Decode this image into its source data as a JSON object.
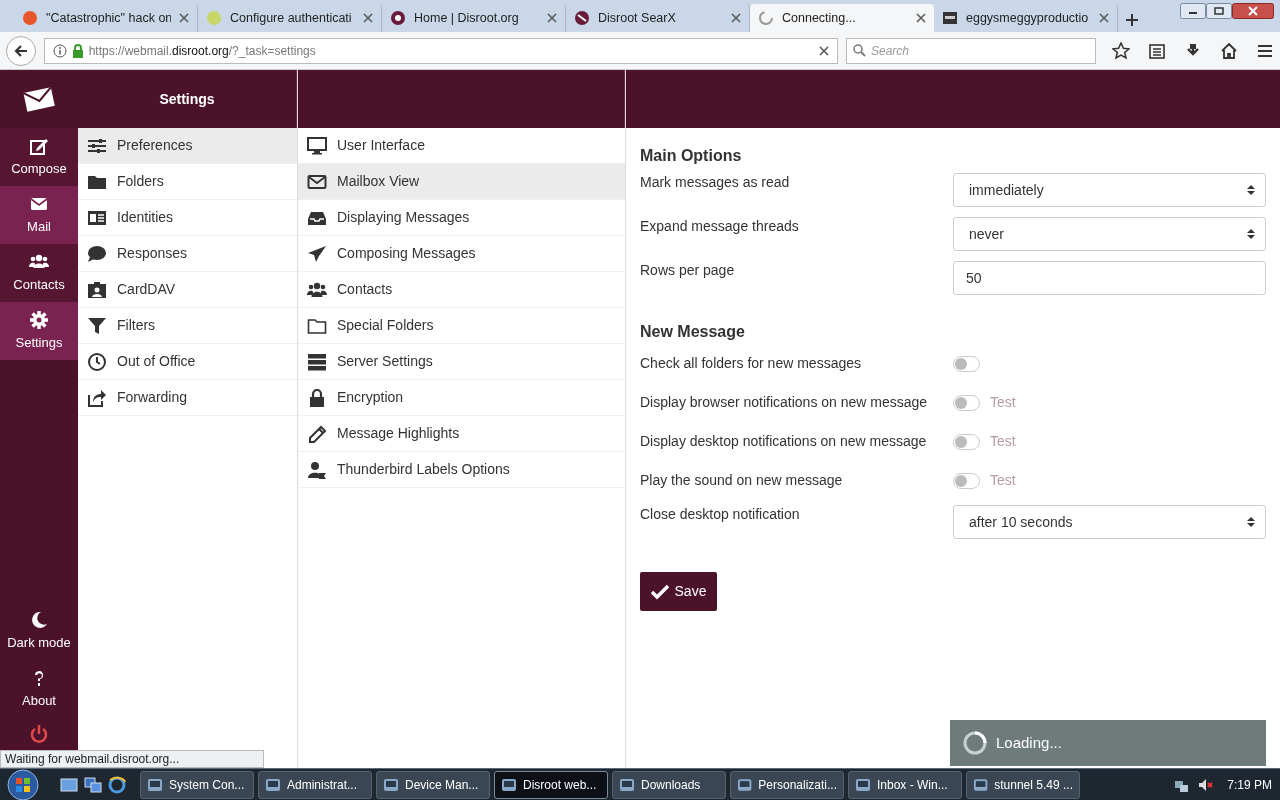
{
  "browser": {
    "tabs": [
      {
        "title": "\"Catastrophic\" hack on",
        "selected": false
      },
      {
        "title": "Configure authenticati",
        "selected": false
      },
      {
        "title": "Home | Disroot.org",
        "selected": false
      },
      {
        "title": "Disroot SearX",
        "selected": false
      },
      {
        "title": "Connecting...",
        "selected": true
      },
      {
        "title": "eggysmeggyproductio",
        "selected": false
      }
    ],
    "url": {
      "prefix": "https://webmail.",
      "domain": "disroot.org",
      "path": "/?_task=settings"
    },
    "search": {
      "placeholder": "Search"
    }
  },
  "rail": {
    "items": [
      {
        "label": "Compose",
        "highlighted": false
      },
      {
        "label": "Mail",
        "highlighted": true
      },
      {
        "label": "Contacts",
        "highlighted": false
      },
      {
        "label": "Settings",
        "highlighted": true
      }
    ],
    "bottom": [
      {
        "label": "Dark mode"
      },
      {
        "label": "About"
      }
    ]
  },
  "header": {
    "title": "Settings"
  },
  "sections": [
    {
      "label": "Preferences",
      "selected": true
    },
    {
      "label": "Folders",
      "selected": false
    },
    {
      "label": "Identities",
      "selected": false
    },
    {
      "label": "Responses",
      "selected": false
    },
    {
      "label": "CardDAV",
      "selected": false
    },
    {
      "label": "Filters",
      "selected": false
    },
    {
      "label": "Out of Office",
      "selected": false
    },
    {
      "label": "Forwarding",
      "selected": false
    }
  ],
  "subsections": [
    {
      "label": "User Interface",
      "selected": false
    },
    {
      "label": "Mailbox View",
      "selected": true
    },
    {
      "label": "Displaying Messages",
      "selected": false
    },
    {
      "label": "Composing Messages",
      "selected": false
    },
    {
      "label": "Contacts",
      "selected": false
    },
    {
      "label": "Special Folders",
      "selected": false
    },
    {
      "label": "Server Settings",
      "selected": false
    },
    {
      "label": "Encryption",
      "selected": false
    },
    {
      "label": "Message Highlights",
      "selected": false
    },
    {
      "label": "Thunderbird Labels Options",
      "selected": false
    }
  ],
  "form": [
    {
      "title": "Main Options",
      "rows": [
        {
          "kind": "select",
          "label": "Mark messages as read",
          "value": "immediately"
        },
        {
          "kind": "select",
          "label": "Expand message threads",
          "value": "never"
        },
        {
          "kind": "text",
          "label": "Rows per page",
          "value": "50"
        }
      ]
    },
    {
      "title": "New Message",
      "rows": [
        {
          "kind": "toggle",
          "label": "Check all folders for new messages",
          "on": false
        },
        {
          "kind": "toggle",
          "label": "Display browser notifications on new message",
          "on": false,
          "test": "Test"
        },
        {
          "kind": "toggle",
          "label": "Display desktop notifications on new message",
          "on": false,
          "test": "Test"
        },
        {
          "kind": "toggle",
          "label": "Play the sound on new message",
          "on": false,
          "test": "Test"
        },
        {
          "kind": "select",
          "label": "Close desktop notification",
          "value": "after 10 seconds"
        }
      ]
    }
  ],
  "save_button": "Save",
  "loading": "Loading...",
  "status_bar": "Waiting for webmail.disroot.org...",
  "taskbar": {
    "buttons": [
      {
        "label": "System Con...",
        "selected": false
      },
      {
        "label": "Administrat...",
        "selected": false
      },
      {
        "label": "Device Man...",
        "selected": false
      },
      {
        "label": "Disroot web...",
        "selected": true
      },
      {
        "label": "Downloads",
        "selected": false
      },
      {
        "label": "Personalizati...",
        "selected": false
      },
      {
        "label": "Inbox - Win...",
        "selected": false
      },
      {
        "label": "stunnel 5.49 ...",
        "selected": false
      }
    ],
    "clock": "7:19 PM"
  }
}
